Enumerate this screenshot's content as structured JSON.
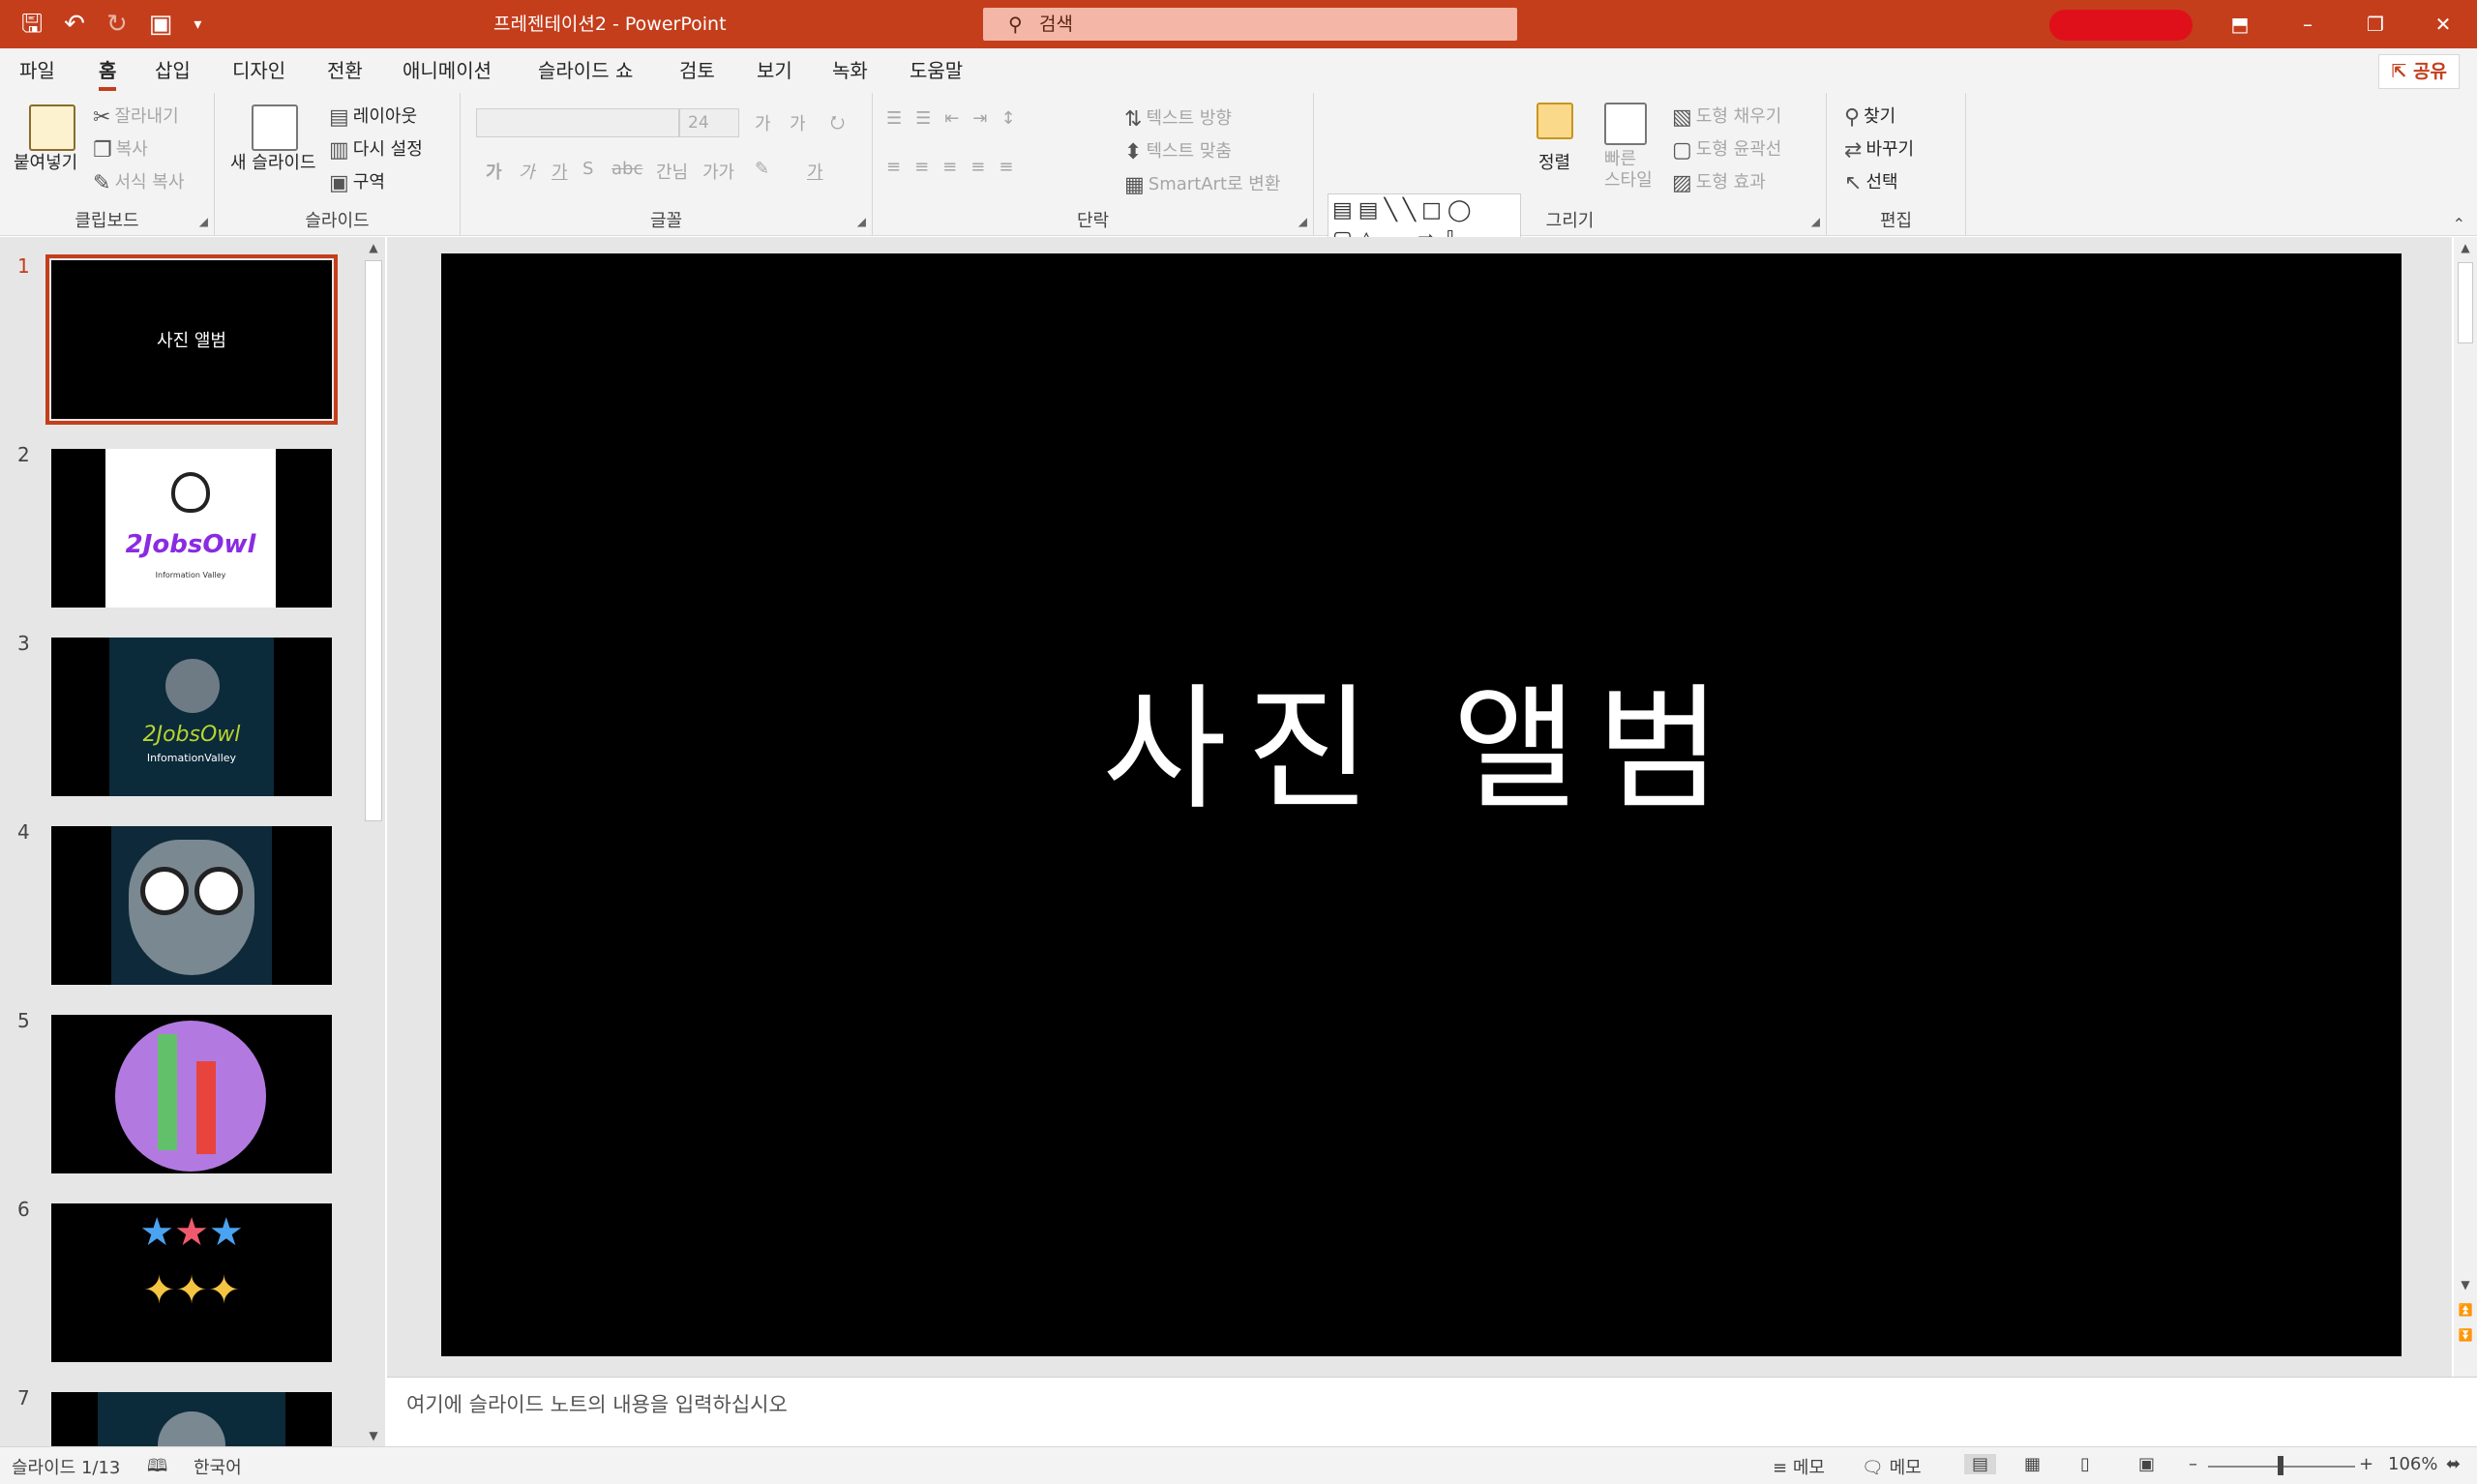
{
  "titlebar": {
    "document_title": "프레젠테이션2  -  PowerPoint",
    "search_placeholder": "검색",
    "qat_icons": [
      "save-icon",
      "undo-icon",
      "redo-icon",
      "start-from-beginning-icon",
      "customize-qat-icon"
    ],
    "window_buttons": [
      "ribbon-display-icon",
      "minimize-icon",
      "restore-icon",
      "close-icon"
    ]
  },
  "menu": {
    "tabs": [
      "파일",
      "홈",
      "삽입",
      "디자인",
      "전환",
      "애니메이션",
      "슬라이드 쇼",
      "검토",
      "보기",
      "녹화",
      "도움말"
    ],
    "active": "홈",
    "share_label": "공유"
  },
  "ribbon": {
    "clipboard": {
      "label": "클립보드",
      "paste": "붙여넣기",
      "cut": "잘라내기",
      "copy": "복사",
      "format_painter": "서식 복사"
    },
    "slides": {
      "label": "슬라이드",
      "new_slide": "새 슬라이드",
      "layout": "레이아웃",
      "reset": "다시 설정",
      "section": "구역"
    },
    "font": {
      "label": "글꼴",
      "font_name": "",
      "font_size": "24",
      "bold": "가",
      "italic": "가",
      "underline": "가",
      "shadow": "S",
      "strike": "abc",
      "spacing": "간님",
      "case": "가가",
      "font_color": "가",
      "grow": "가",
      "shrink": "가"
    },
    "paragraph": {
      "label": "단락",
      "text_direction": "텍스트 방향",
      "align_text": "텍스트 맞춤",
      "smartart": "SmartArt로 변환"
    },
    "drawing": {
      "label": "그리기",
      "arrange": "정렬",
      "quick_styles": "빠른\n스타일",
      "fill": "도형 채우기",
      "outline": "도형 윤곽선",
      "effects": "도형 효과"
    },
    "editing": {
      "label": "편집",
      "find": "찾기",
      "replace": "바꾸기",
      "select": "선택"
    }
  },
  "slides": [
    {
      "number": "1",
      "title": "사진 앨범",
      "selected": true
    },
    {
      "number": "2",
      "title": "2JobsOwl",
      "subtitle": "Information Valley",
      "selected": false
    },
    {
      "number": "3",
      "title": "2JobsOwl",
      "subtitle": "InfomationValley",
      "selected": false
    },
    {
      "number": "4",
      "title": "",
      "selected": false
    },
    {
      "number": "5",
      "title": "",
      "selected": false
    },
    {
      "number": "6",
      "title": "",
      "selected": false
    },
    {
      "number": "7",
      "title": "",
      "selected": false
    }
  ],
  "main_slide": {
    "title": "사진 앨범"
  },
  "notes": {
    "placeholder": "여기에 슬라이드 노트의 내용을 입력하십시오"
  },
  "status": {
    "slide_counter": "슬라이드 1/13",
    "language": "한국어",
    "notes_label": "메모",
    "comments_label": "메모",
    "zoom": "106%"
  },
  "colors": {
    "accent": "#c43e1c",
    "slide_bg": "#000000",
    "chrome_bg": "#f3f3f3"
  }
}
